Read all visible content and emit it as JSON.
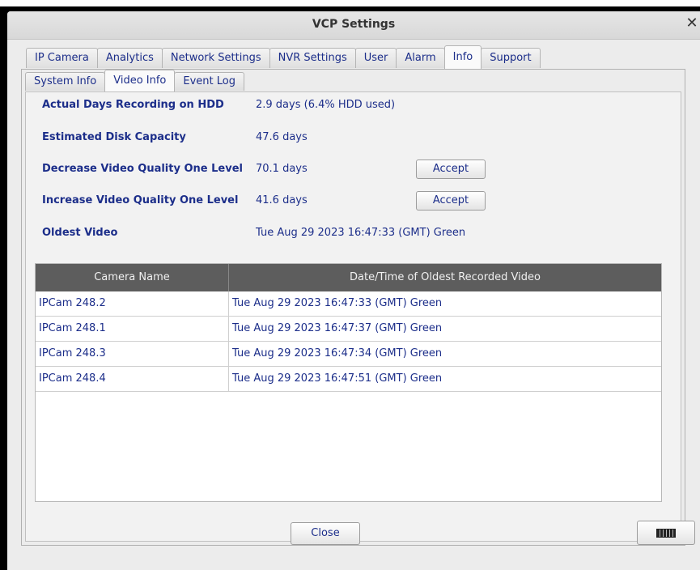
{
  "window": {
    "title": "VCP Settings",
    "close_glyph": "✕"
  },
  "tabs": [
    {
      "label": "IP Camera"
    },
    {
      "label": "Analytics"
    },
    {
      "label": "Network Settings"
    },
    {
      "label": "NVR Settings"
    },
    {
      "label": "User"
    },
    {
      "label": "Alarm"
    },
    {
      "label": "Info",
      "active": true
    },
    {
      "label": "Support"
    }
  ],
  "subtabs": [
    {
      "label": "System Info"
    },
    {
      "label": "Video Info",
      "active": true
    },
    {
      "label": "Event Log"
    }
  ],
  "info": {
    "actual_days": {
      "label": "Actual Days Recording on HDD",
      "value": "2.9 days (6.4% HDD used)"
    },
    "estimated_capacity": {
      "label": "Estimated Disk Capacity",
      "value": "47.6 days"
    },
    "decrease_quality": {
      "label": "Decrease Video Quality One Level",
      "value": "70.1 days",
      "button": "Accept"
    },
    "increase_quality": {
      "label": "Increase Video Quality One Level",
      "value": "41.6 days",
      "button": "Accept"
    },
    "oldest_video": {
      "label": "Oldest Video",
      "value": "Tue Aug 29 2023 16:47:33 (GMT) Green"
    }
  },
  "table": {
    "headers": [
      "Camera Name",
      "Date/Time of Oldest Recorded Video"
    ],
    "rows": [
      [
        "IPCam 248.2",
        "Tue Aug 29 2023 16:47:33 (GMT) Green"
      ],
      [
        "IPCam 248.1",
        "Tue Aug 29 2023 16:47:37 (GMT) Green"
      ],
      [
        "IPCam 248.3",
        "Tue Aug 29 2023 16:47:34 (GMT) Green"
      ],
      [
        "IPCam 248.4",
        "Tue Aug 29 2023 16:47:51 (GMT) Green"
      ]
    ]
  },
  "footer": {
    "close_label": "Close",
    "keyboard_icon": "keyboard-icon"
  }
}
